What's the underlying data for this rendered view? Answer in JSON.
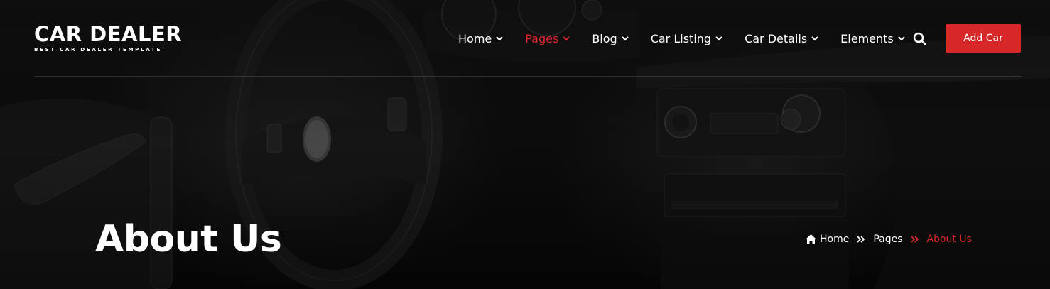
{
  "brand": {
    "name": "CAR DEALER",
    "tagline": "BEST CAR DEALER TEMPLATE"
  },
  "nav": {
    "items": [
      {
        "label": "Home",
        "active": false
      },
      {
        "label": "Pages",
        "active": true
      },
      {
        "label": "Blog",
        "active": false
      },
      {
        "label": "Car Listing",
        "active": false
      },
      {
        "label": "Car Details",
        "active": false
      },
      {
        "label": "Elements",
        "active": false
      }
    ],
    "cta_label": "Add Car"
  },
  "page": {
    "title": "About Us"
  },
  "breadcrumb": {
    "items": [
      "Home",
      "Pages",
      "About Us"
    ]
  },
  "colors": {
    "accent": "#d62828",
    "background": "#0b0b0b",
    "text": "#ffffff"
  },
  "icons": {
    "search": "search-icon",
    "home": "home-icon",
    "chevron": "chevron-down-icon",
    "separator": "double-chevron-right-icon"
  }
}
